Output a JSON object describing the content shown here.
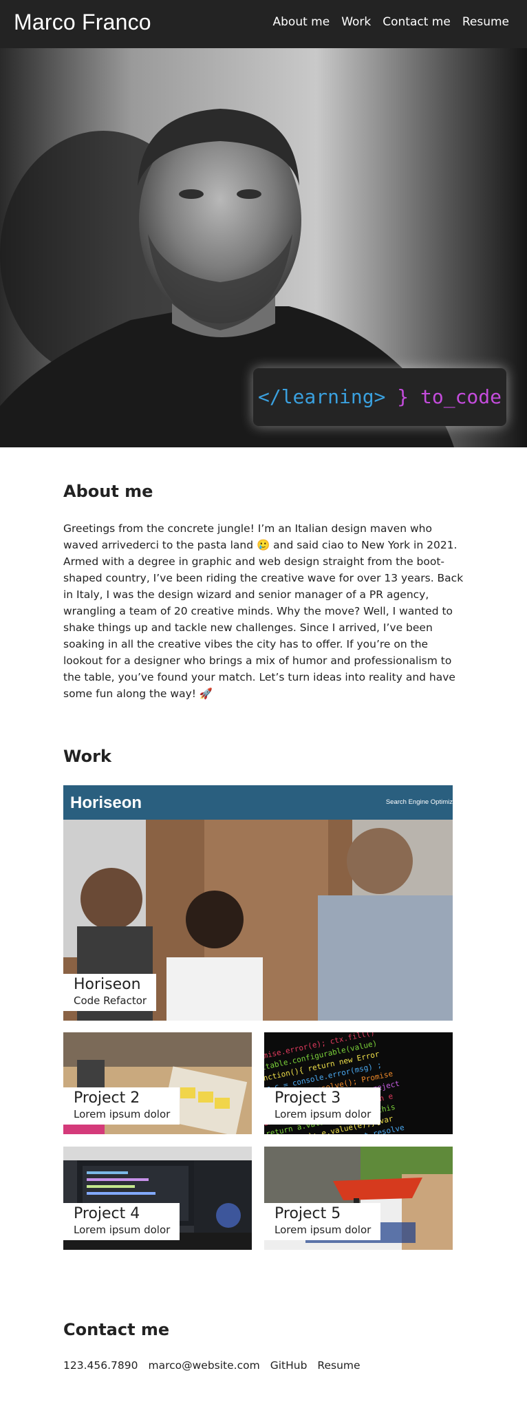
{
  "header": {
    "brand": "Marco Franco",
    "nav": [
      "About me",
      "Work",
      "Contact me",
      "Resume"
    ]
  },
  "hero": {
    "badge_open": "</learning>",
    "badge_close": "} to_code"
  },
  "about": {
    "title": "About me",
    "text": "Greetings from the concrete jungle! I’m an Italian design maven who waved arrivederci to the pasta land 🥲 and said ciao to New York in 2021. Armed with a degree in graphic and web design straight from the boot-shaped country, I’ve been riding the creative wave for over 13 years. Back in Italy, I was the design wizard and senior manager of a PR agency, wrangling a team of 20 creative minds. Why the move? Well, I wanted to shake things up and tackle new challenges. Since I arrived, I’ve been soaking in all the creative vibes the city has to offer. If you’re on the lookout for a designer who brings a mix of humor and professionalism to the table, you’ve found your match. Let’s turn ideas into reality and have some fun along the way! 🚀"
  },
  "work": {
    "title": "Work",
    "featured": {
      "site_logo": "Horiseon",
      "site_nav": "Search Engine Optimiz",
      "title": "Horiseon",
      "subtitle": "Code Refactor"
    },
    "projects": [
      {
        "title": "Project 2",
        "subtitle": "Lorem ipsum dolor"
      },
      {
        "title": "Project 3",
        "subtitle": "Lorem ipsum dolor"
      },
      {
        "title": "Project 4",
        "subtitle": "Lorem ipsum dolor"
      },
      {
        "title": "Project 5",
        "subtitle": "Lorem ipsum dolor"
      }
    ]
  },
  "contact": {
    "title": "Contact me",
    "phone": "123.456.7890",
    "email": "marco@website.com",
    "github": "GitHub",
    "resume": "Resume"
  },
  "colors": {
    "header_bg": "#232323",
    "badge_open": "#3aa0de",
    "badge_close": "#c44cdc",
    "horiseon_bar": "#2a5f7f"
  }
}
